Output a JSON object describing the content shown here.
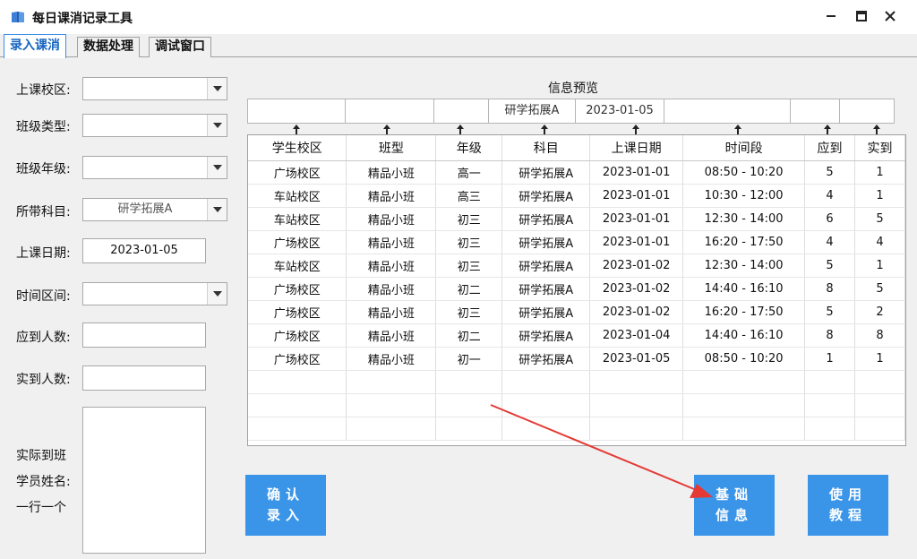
{
  "window": {
    "title": "每日课消记录工具"
  },
  "tabs": [
    {
      "label": "录入课消",
      "active": true
    },
    {
      "label": "数据处理",
      "active": false
    },
    {
      "label": "调试窗口",
      "active": false
    }
  ],
  "form": {
    "campus_label": "上课校区:",
    "campus_value": "",
    "class_type_label": "班级类型:",
    "class_type_value": "",
    "grade_label": "班级年级:",
    "grade_value": "",
    "subject_label": "所带科目:",
    "subject_value": "研学拓展A",
    "date_label": "上课日期:",
    "date_value": "2023-01-05",
    "time_label": "时间区间:",
    "time_value": "",
    "expected_label": "应到人数:",
    "expected_value": "",
    "actual_label": "实到人数:",
    "actual_value": "",
    "names_label_1": "实际到班",
    "names_label_2": "学员姓名:",
    "names_label_3": "一行一个",
    "names_value": ""
  },
  "preview": {
    "title": "信息预览",
    "cells": [
      "",
      "",
      "",
      "研学拓展A",
      "2023-01-05",
      "",
      "",
      ""
    ]
  },
  "table": {
    "headers": [
      "学生校区",
      "班型",
      "年级",
      "科目",
      "上课日期",
      "时间段",
      "应到",
      "实到"
    ],
    "rows": [
      [
        "广场校区",
        "精品小班",
        "高一",
        "研学拓展A",
        "2023-01-01",
        "08:50 - 10:20",
        "5",
        "1"
      ],
      [
        "车站校区",
        "精品小班",
        "高三",
        "研学拓展A",
        "2023-01-01",
        "10:30 - 12:00",
        "4",
        "1"
      ],
      [
        "车站校区",
        "精品小班",
        "初三",
        "研学拓展A",
        "2023-01-01",
        "12:30 - 14:00",
        "6",
        "5"
      ],
      [
        "广场校区",
        "精品小班",
        "初三",
        "研学拓展A",
        "2023-01-01",
        "16:20 - 17:50",
        "4",
        "4"
      ],
      [
        "车站校区",
        "精品小班",
        "初三",
        "研学拓展A",
        "2023-01-02",
        "12:30 - 14:00",
        "5",
        "1"
      ],
      [
        "广场校区",
        "精品小班",
        "初二",
        "研学拓展A",
        "2023-01-02",
        "14:40 - 16:10",
        "8",
        "5"
      ],
      [
        "广场校区",
        "精品小班",
        "初三",
        "研学拓展A",
        "2023-01-02",
        "16:20 - 17:50",
        "5",
        "2"
      ],
      [
        "广场校区",
        "精品小班",
        "初二",
        "研学拓展A",
        "2023-01-04",
        "14:40 - 16:10",
        "8",
        "8"
      ],
      [
        "广场校区",
        "精品小班",
        "初一",
        "研学拓展A",
        "2023-01-05",
        "08:50 - 10:20",
        "1",
        "1"
      ]
    ]
  },
  "buttons": {
    "confirm_line1": "确认",
    "confirm_line2": "录入",
    "base_info_line1": "基础",
    "base_info_line2": "信息",
    "tutorial_line1": "使用",
    "tutorial_line2": "教程"
  },
  "colors": {
    "accent": "#3a95e8",
    "annotation_arrow": "#e53935"
  }
}
